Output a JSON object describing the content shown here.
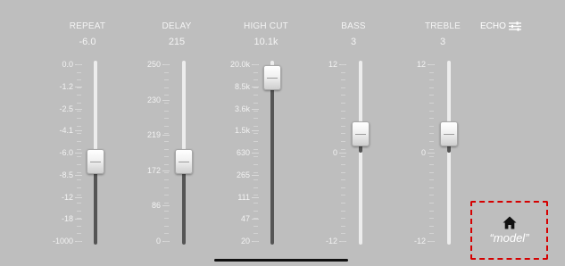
{
  "controls": [
    {
      "name": "REPEAT",
      "value": "-6.0",
      "ticks": [
        "0.0",
        "-1.2",
        "-2.5",
        "-4.1",
        "-6.0",
        "-8.5",
        "-12",
        "-18",
        "-1000"
      ],
      "level": 0.45
    },
    {
      "name": "DELAY",
      "value": "215",
      "ticks": [
        "250",
        "230",
        "219",
        "172",
        "86",
        "0"
      ],
      "level": 0.45
    },
    {
      "name": "HIGH CUT",
      "value": "10.1k",
      "ticks": [
        "20.0k",
        "8.5k",
        "3.6k",
        "1.5k",
        "630",
        "265",
        "111",
        "47",
        "20"
      ],
      "level": 0.91
    },
    {
      "name": "BASS",
      "value": "3",
      "ticks": [
        "12",
        "0",
        "-12"
      ],
      "level": 0.6
    },
    {
      "name": "TREBLE",
      "value": "3",
      "ticks": [
        "12",
        "0",
        "-12"
      ],
      "level": 0.6
    }
  ],
  "echo": {
    "label": "ECHO",
    "icon": "sliders-icon"
  },
  "home": {
    "label": "“model”",
    "icon": "home-icon"
  },
  "colors": {
    "background": "#bebebe",
    "fill": "#555555",
    "highlight": "#d50000"
  }
}
